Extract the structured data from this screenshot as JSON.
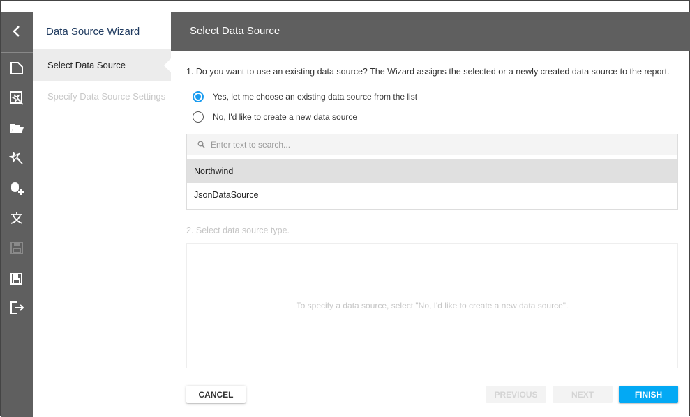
{
  "toolbar": {
    "items": [
      "back-icon",
      "new-report-icon",
      "new-report-via-wizard-icon",
      "open-icon",
      "wizard-icon",
      "add-data-source-icon",
      "localization-icon",
      "save-icon",
      "save-as-icon",
      "exit-icon"
    ]
  },
  "steps": {
    "title": "Data Source Wizard",
    "items": [
      {
        "label": "Select Data Source",
        "active": true
      },
      {
        "label": "Specify Data Source Settings",
        "active": false
      }
    ]
  },
  "header": {
    "title": "Select Data Source"
  },
  "main": {
    "question1": "1. Do you want to use an existing data source? The Wizard assigns the selected or a newly created data source to the report.",
    "options": [
      {
        "label": "Yes, let me choose an existing data source from the list",
        "checked": true
      },
      {
        "label": "No, I'd like to create a new data source",
        "checked": false
      }
    ],
    "search_placeholder": "Enter text to search...",
    "data_sources": [
      {
        "name": "Northwind",
        "selected": true
      },
      {
        "name": "JsonDataSource",
        "selected": false
      }
    ],
    "question2": "2. Select data source type.",
    "hint": "To specify a data source, select \"No, I'd like to create a new data source\"."
  },
  "buttons": {
    "cancel": "CANCEL",
    "previous": "PREVIOUS",
    "next": "NEXT",
    "finish": "FINISH"
  },
  "colors": {
    "accent": "#03a9f4",
    "toolbar": "#5f5f5f"
  }
}
